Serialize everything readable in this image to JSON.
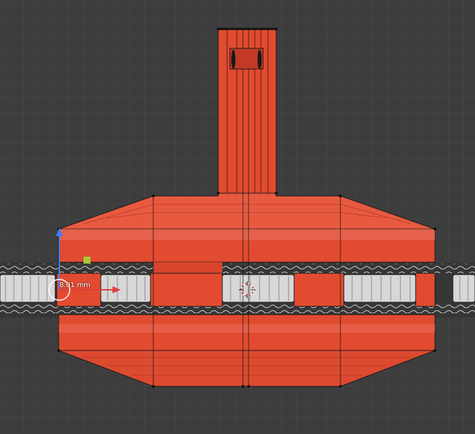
{
  "viewport": {
    "background": "#3d3d3d",
    "grid_color": "#4a4a4a",
    "mesh_color": "#e24b30",
    "mesh_light": "#ea7562",
    "chain_color": "#b8b8b8",
    "axis_y_color": "#3f7fff",
    "axis_x_color": "#e23c3c",
    "gizmo_color": "#a5c93a"
  },
  "measure": {
    "value_label": "8.01 mm"
  },
  "icons": {
    "cursor": "3d-cursor-icon",
    "transform": "transform-gizmo-icon"
  }
}
